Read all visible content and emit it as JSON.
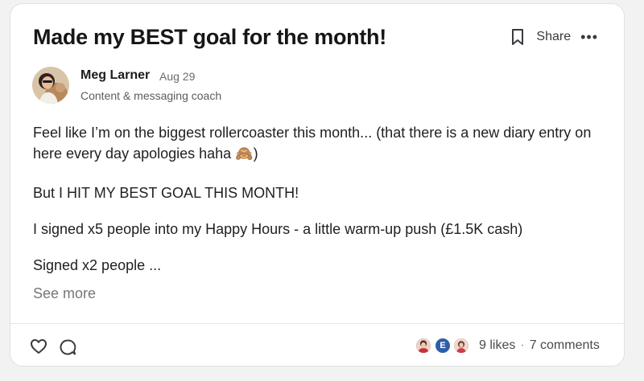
{
  "post": {
    "title": "Made my BEST goal for the month!",
    "actions": {
      "share_label": "Share",
      "bookmark_icon": "bookmark-icon",
      "more_icon": "more-options-icon"
    },
    "author": {
      "name": "Meg Larner",
      "date": "Aug 29",
      "role": "Content & messaging coach"
    },
    "body": [
      "Feel like I’m on the biggest rollercoaster this month... (that there is a new diary entry on here every day apologies haha 🙈)",
      "But I HIT MY BEST GOAL THIS MONTH!",
      "I signed x5 people into my Happy Hours - a little warm-up push (£1.5K cash)",
      "Signed x2 people ..."
    ],
    "see_more": "See more"
  },
  "footer": {
    "like_icon": "heart-icon",
    "comment_icon": "comment-icon",
    "likers": [
      {
        "initial": "",
        "color": "#b8323e"
      },
      {
        "initial": "E",
        "color": "#2f5fa8"
      },
      {
        "initial": "",
        "color": "#c9424a"
      }
    ],
    "likes": "9 likes",
    "separator": "·",
    "comments": "7 comments"
  }
}
